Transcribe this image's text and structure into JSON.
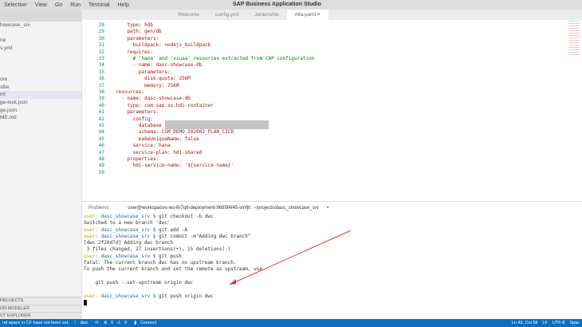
{
  "menu": [
    "Selection",
    "View",
    "Go",
    "Run",
    "Terminal",
    "Help"
  ],
  "app_title": "SAP Business Application Studio",
  "sidebar": {
    "items": [
      {
        "label": "howcase_srv"
      },
      {
        "label": ""
      },
      {
        "label": "ne"
      },
      {
        "label": "s.yml"
      },
      {
        "label": ""
      },
      {
        "label": ""
      },
      {
        "label": ""
      },
      {
        "label": "ore"
      },
      {
        "label": "sfile"
      },
      {
        "label": "ml"
      },
      {
        "label": "ge-lock.json"
      },
      {
        "label": "ge.json"
      },
      {
        "label": "ME.md"
      }
    ],
    "sections": [
      "PROJECTS",
      "ON MODELER",
      "CT EXPLORER"
    ]
  },
  "tabs": [
    "Welcome",
    "config.yml",
    "Jenkinsfile",
    "mta.yaml"
  ],
  "editor": {
    "lines": [
      {
        "n": "28",
        "t": "    type: hdb"
      },
      {
        "n": "29",
        "t": "    path: gen/db"
      },
      {
        "n": "30",
        "t": "    parameters:"
      },
      {
        "n": "31",
        "t": "      buildpack: nodejs_buildpack"
      },
      {
        "n": "32",
        "t": "    requires:"
      },
      {
        "n": "33",
        "t": "      # 'hana' and 'xsuaa' resources extracted from CAP configuration"
      },
      {
        "n": "34",
        "t": "      - name: dasc-showcase-db"
      },
      {
        "n": "35",
        "t": "        parameters:"
      },
      {
        "n": "36",
        "t": "          disk-quota: 256M"
      },
      {
        "n": "37",
        "t": "          memory: 256M"
      },
      {
        "n": "38",
        "t": "resources:"
      },
      {
        "n": "39",
        "t": "  - name: dasc-showcase-db"
      },
      {
        "n": "40",
        "t": "    type: com.sap.xs.hdi-container"
      },
      {
        "n": "41",
        "t": "    parameters:"
      },
      {
        "n": "42",
        "t": "      config:"
      },
      {
        "n": "43",
        "t": "        database_id:"
      },
      {
        "n": "44",
        "t": "        schema: CSM_DEMO_202002_PLAN_CICD"
      },
      {
        "n": "45",
        "t": "        makeUniqueName: false"
      },
      {
        "n": "46",
        "t": "      service: hana"
      },
      {
        "n": "47",
        "t": "      service-plan: hdi-shared"
      },
      {
        "n": "48",
        "t": "    properties:"
      },
      {
        "n": "49",
        "t": "      hdi-service-name: '${service-name}'"
      },
      {
        "n": "50",
        "t": ""
      }
    ]
  },
  "panel": {
    "tabs": [
      "Problems",
      "user@workspaces-ws-6r7q8-deployment-9685f4f45-smfjh: ~/projects/dasc_showcase_srv"
    ],
    "terminal": [
      {
        "u": "user: ",
        "p": "dasc_showcase_srv $ ",
        "t": "git checkout -b dwc"
      },
      {
        "t": "Switched to a new branch 'dwc'"
      },
      {
        "u": "user: ",
        "p": "dasc_showcase_srv $ ",
        "t": "git add -A"
      },
      {
        "u": "user: ",
        "p": "dasc_showcase_srv $ ",
        "t": "git commit -m\"Adding dwc branch\""
      },
      {
        "t": "[dwc 2f20d7d] Adding dwc branch"
      },
      {
        "t": " 3 files changed, 27 insertions(+), 15 deletions(-)"
      },
      {
        "u": "user: ",
        "p": "dasc_showcase_srv $ ",
        "t": "git push"
      },
      {
        "t": "fatal: The current branch dwc has no upstream branch."
      },
      {
        "t": "To push the current branch and set the remote as upstream, use"
      },
      {
        "t": ""
      },
      {
        "t": "    git push --set-upstream origin dwc"
      },
      {
        "t": ""
      },
      {
        "u": "user: ",
        "p": "dasc_showcase_srv $ ",
        "t": "git push origin dwc"
      }
    ]
  },
  "status": {
    "message": "nd space in CF have not been set.",
    "branch": "dwc",
    "errors": "0",
    "warnings": "0",
    "connect": "Connect",
    "position": "Ln 43, Col 58",
    "eol": "LF",
    "encoding": "UTF-8",
    "indent": "Spac"
  }
}
